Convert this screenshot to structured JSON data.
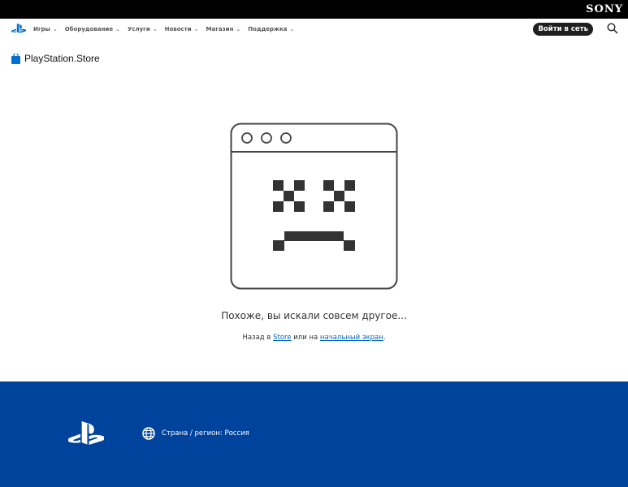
{
  "brand": {
    "sony": "SONY",
    "store": "PlayStation.Store"
  },
  "nav": {
    "items": [
      {
        "label": "Игры"
      },
      {
        "label": "Оборудование"
      },
      {
        "label": "Услуги"
      },
      {
        "label": "Новости"
      },
      {
        "label": "Магазин"
      },
      {
        "label": "Поддержка"
      }
    ],
    "signin": "Войти в сеть"
  },
  "error": {
    "message": "Похоже, вы искали совсем другое...",
    "back_prefix": "Назад в ",
    "store_link": "Store",
    "middle": " или на ",
    "home_link": "начальный экран",
    "suffix": "."
  },
  "footer": {
    "region": "Страна / регион: Россия"
  },
  "colors": {
    "footer": "#00439c",
    "link": "#0068c8",
    "ps_blue": "#0070d1"
  }
}
